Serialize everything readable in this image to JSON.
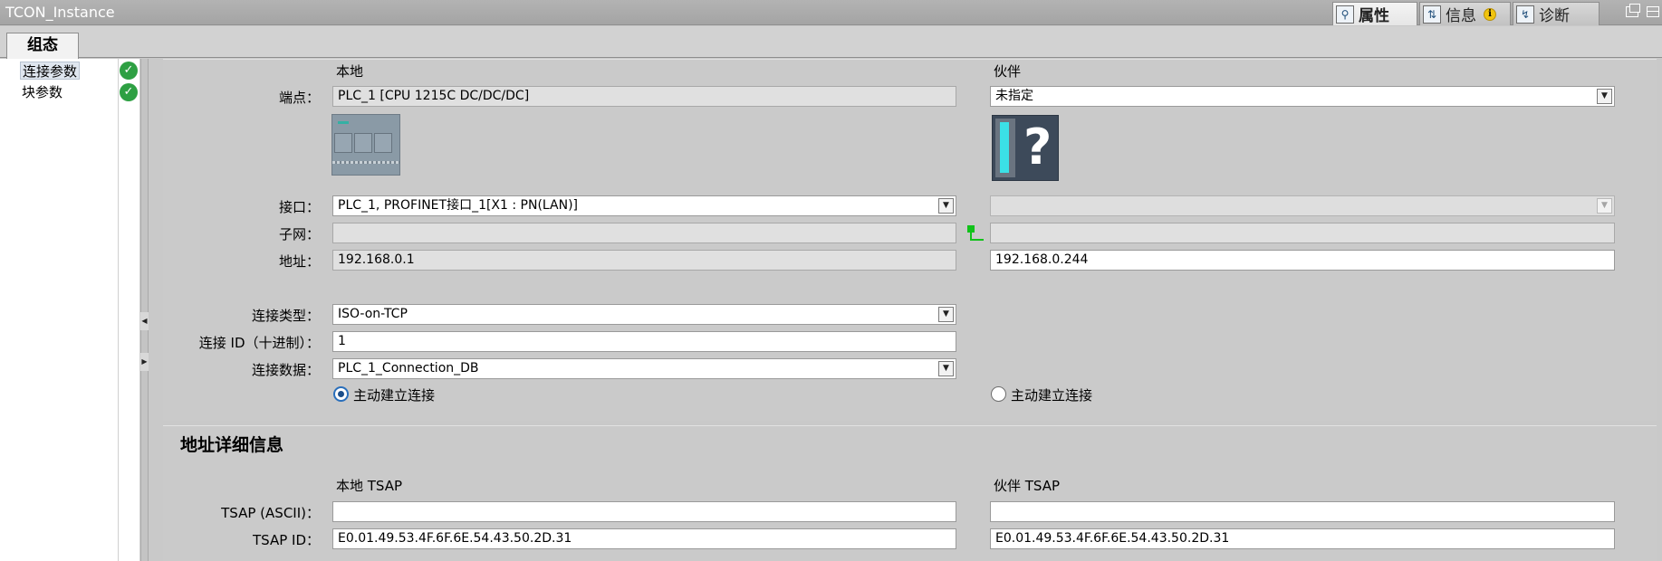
{
  "window": {
    "title": "TCON_Instance"
  },
  "panel_tabs": [
    {
      "label": "属性",
      "icon": "properties-icon"
    },
    {
      "label": "信息",
      "icon": "info-icon"
    },
    {
      "label": "诊断",
      "icon": "diagnostics-icon"
    }
  ],
  "tabs": {
    "config": "组态"
  },
  "nav": {
    "items": [
      {
        "label": "连接参数",
        "status": "ok"
      },
      {
        "label": "块参数",
        "status": "ok"
      }
    ]
  },
  "columns": {
    "local": "本地",
    "partner": "伙伴"
  },
  "labels": {
    "endpoint": "端点：",
    "interface": "接口：",
    "subnet": "子网：",
    "address": "地址：",
    "conn_type": "连接类型：",
    "conn_id": "连接 ID（十进制）：",
    "conn_data": "连接数据："
  },
  "local": {
    "endpoint": "PLC_1 [CPU 1215C DC/DC/DC]",
    "interface": "PLC_1, PROFINET接口_1[X1 : PN(LAN)]",
    "subnet": "",
    "address": "192.168.0.1",
    "conn_type": "ISO-on-TCP",
    "conn_id": "1",
    "conn_data": "PLC_1_Connection_DB",
    "active_label": "主动建立连接",
    "active_selected": true
  },
  "partner": {
    "endpoint": "未指定",
    "interface": "",
    "subnet": "",
    "address": "192.168.0.244",
    "active_label": "主动建立连接",
    "active_selected": false
  },
  "address_details": {
    "title": "地址详细信息",
    "local_header": "本地 TSAP",
    "partner_header": "伙伴 TSAP",
    "ascii_label": "TSAP (ASCII)：",
    "id_label": "TSAP ID：",
    "local_ascii": "",
    "partner_ascii": "",
    "local_id": "E0.01.49.53.4F.6F.6E.54.43.50.2D.31",
    "partner_id": "E0.01.49.53.4F.6F.6E.54.43.50.2D.31"
  },
  "colors": {
    "ok": "#2ea043",
    "radio_selected": "#1c4e8a",
    "subnet_link": "#11c21a"
  }
}
